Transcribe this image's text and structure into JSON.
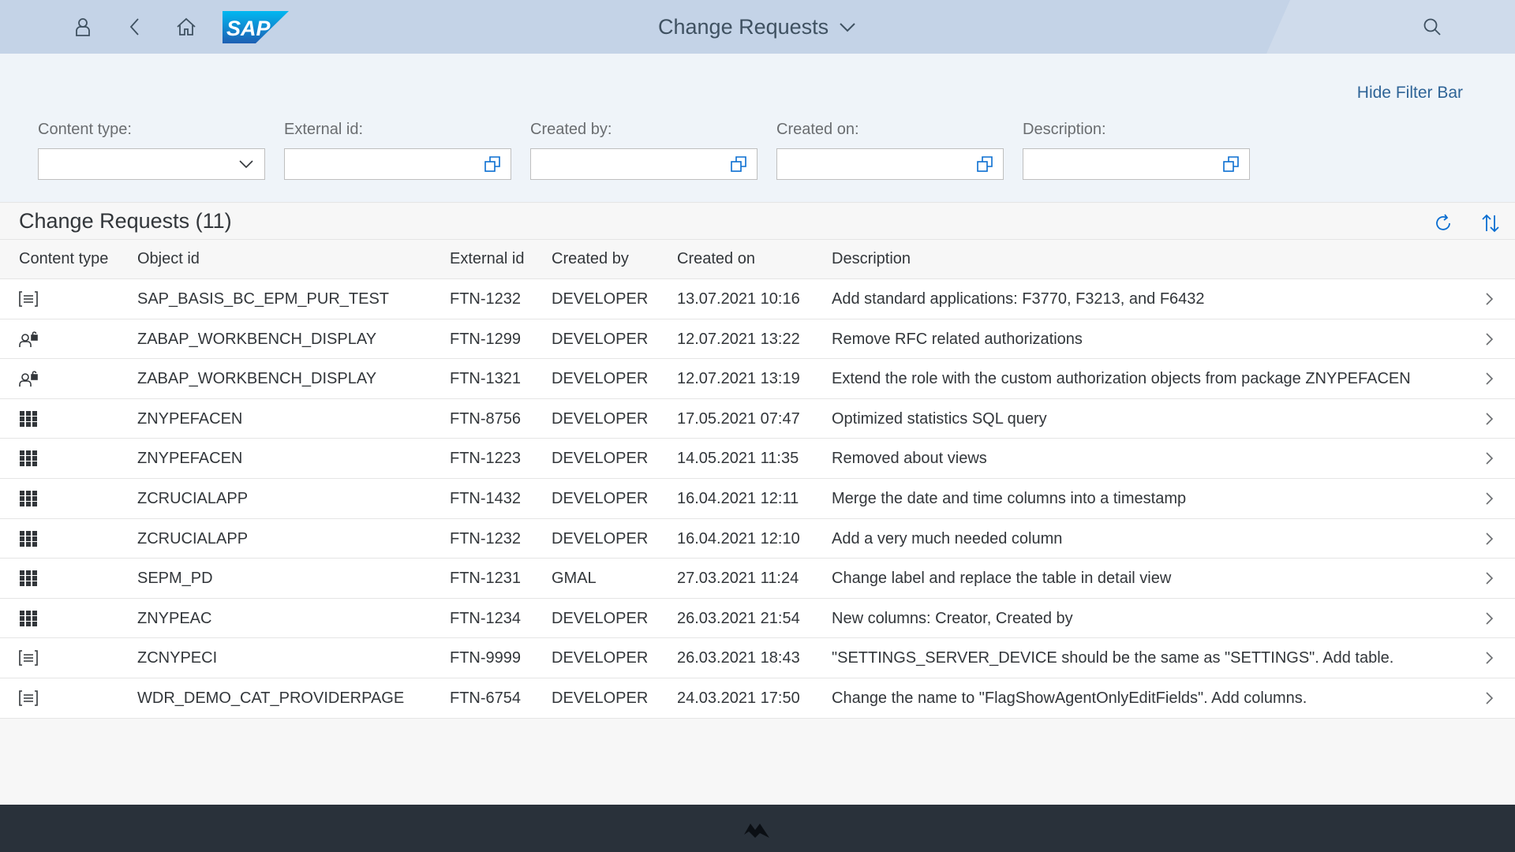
{
  "shell": {
    "title": "Change Requests",
    "icons": {
      "user": "user-icon",
      "back": "back-icon",
      "home": "home-icon",
      "search": "search-icon",
      "title_dropdown": "chevron-down-icon"
    },
    "logo_text": "SAP",
    "colors": {
      "header_bg": "#c4d3e7",
      "accent": "#0a6ed1",
      "logo_blue": "#1a8bd6",
      "footer_bg": "#29313a"
    }
  },
  "filterbar": {
    "hide_label": "Hide Filter Bar",
    "filters": [
      {
        "label": "Content type:",
        "value": "",
        "kind": "select"
      },
      {
        "label": "External id:",
        "value": "",
        "kind": "value-help"
      },
      {
        "label": "Created by:",
        "value": "",
        "kind": "value-help"
      },
      {
        "label": "Created on:",
        "value": "",
        "kind": "value-help"
      },
      {
        "label": "Description:",
        "value": "",
        "kind": "value-help"
      }
    ]
  },
  "table": {
    "title": "Change Requests (11)",
    "toolbar_icons": [
      "refresh-icon",
      "sort-icon"
    ],
    "columns": [
      "Content type",
      "Object id",
      "External id",
      "Created by",
      "Created on",
      "Description"
    ],
    "rows": [
      {
        "type_icon": "document-list-icon",
        "object_id": "SAP_BASIS_BC_EPM_PUR_TEST",
        "external_id": "FTN-1232",
        "created_by": "DEVELOPER",
        "created_on": "13.07.2021 10:16",
        "description": "Add standard applications: F3770, F3213, and F6432"
      },
      {
        "type_icon": "user-lock-icon",
        "object_id": "ZABAP_WORKBENCH_DISPLAY",
        "external_id": "FTN-1299",
        "created_by": "DEVELOPER",
        "created_on": "12.07.2021 13:22",
        "description": "Remove RFC related authorizations"
      },
      {
        "type_icon": "user-lock-icon",
        "object_id": "ZABAP_WORKBENCH_DISPLAY",
        "external_id": "FTN-1321",
        "created_by": "DEVELOPER",
        "created_on": "12.07.2021 13:19",
        "description": "Extend the role with the custom authorization objects from package ZNYPEFACEN"
      },
      {
        "type_icon": "app-grid-icon",
        "object_id": "ZNYPEFACEN",
        "external_id": "FTN-8756",
        "created_by": "DEVELOPER",
        "created_on": "17.05.2021 07:47",
        "description": "Optimized statistics SQL query"
      },
      {
        "type_icon": "app-grid-icon",
        "object_id": "ZNYPEFACEN",
        "external_id": "FTN-1223",
        "created_by": "DEVELOPER",
        "created_on": "14.05.2021 11:35",
        "description": "Removed about views"
      },
      {
        "type_icon": "app-grid-icon",
        "object_id": "ZCRUCIALAPP",
        "external_id": "FTN-1432",
        "created_by": "DEVELOPER",
        "created_on": "16.04.2021 12:11",
        "description": "Merge the date and time columns into a timestamp"
      },
      {
        "type_icon": "app-grid-icon",
        "object_id": "ZCRUCIALAPP",
        "external_id": "FTN-1232",
        "created_by": "DEVELOPER",
        "created_on": "16.04.2021 12:10",
        "description": "Add a very much needed column"
      },
      {
        "type_icon": "app-grid-icon",
        "object_id": "SEPM_PD",
        "external_id": "FTN-1231",
        "created_by": "GMAL",
        "created_on": "27.03.2021 11:24",
        "description": "Change label and replace the table in detail view"
      },
      {
        "type_icon": "app-grid-icon",
        "object_id": "ZNYPEAC",
        "external_id": "FTN-1234",
        "created_by": "DEVELOPER",
        "created_on": "26.03.2021 21:54",
        "description": "New columns: Creator, Created by"
      },
      {
        "type_icon": "document-list-icon",
        "object_id": "ZCNYPECI",
        "external_id": "FTN-9999",
        "created_by": "DEVELOPER",
        "created_on": "26.03.2021 18:43",
        "description": "\"SETTINGS_SERVER_DEVICE should be the same as \"SETTINGS\". Add table."
      },
      {
        "type_icon": "document-list-icon",
        "object_id": "WDR_DEMO_CAT_PROVIDERPAGE",
        "external_id": "FTN-6754",
        "created_by": "DEVELOPER",
        "created_on": "24.03.2021 17:50",
        "description": "Change the name to \"FlagShowAgentOnlyEditFields\". Add columns."
      }
    ]
  },
  "footer": {
    "logo_icon": "footer-logo-icon"
  }
}
